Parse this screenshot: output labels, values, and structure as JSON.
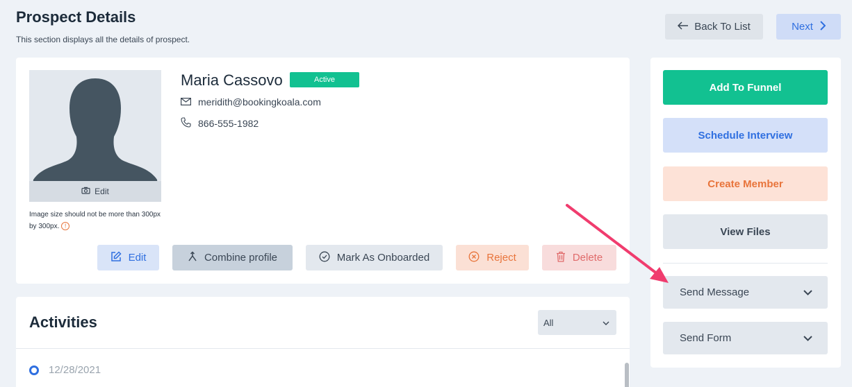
{
  "header": {
    "title": "Prospect Details",
    "subtitle": "This section displays all the details of prospect.",
    "back_label": "Back To List",
    "next_label": "Next"
  },
  "profile": {
    "name": "Maria Cassovo",
    "status": "Active",
    "email": "meridith@bookingkoala.com",
    "phone": "866-555-1982",
    "avatar_edit_label": "Edit",
    "image_note": "Image size should not be more than 300px by 300px.",
    "actions": {
      "edit": "Edit",
      "combine": "Combine profile",
      "onboard": "Mark As Onboarded",
      "reject": "Reject",
      "delete": "Delete"
    }
  },
  "activities": {
    "title": "Activities",
    "filter_value": "All",
    "items": [
      {
        "date": "12/28/2021"
      }
    ]
  },
  "sidebar": {
    "add_to_funnel": "Add To Funnel",
    "schedule_interview": "Schedule Interview",
    "create_member": "Create Member",
    "view_files": "View Files",
    "send_message": "Send Message",
    "send_form": "Send Form"
  },
  "colors": {
    "accent_green": "#12c191",
    "accent_blue": "#2f6fe0",
    "accent_orange": "#e8743b",
    "accent_red": "#e06b6b",
    "annotation_arrow": "#f03c6e"
  },
  "icons": {
    "back": "arrow-left-icon",
    "next": "chevron-right-icon",
    "email": "envelope-icon",
    "phone": "phone-icon",
    "camera": "camera-icon",
    "info": "info-icon",
    "edit": "pencil-square-icon",
    "combine": "merge-icon",
    "onboard": "check-circle-icon",
    "reject": "x-circle-icon",
    "delete": "trash-icon",
    "dropdown": "chevron-down-icon"
  }
}
